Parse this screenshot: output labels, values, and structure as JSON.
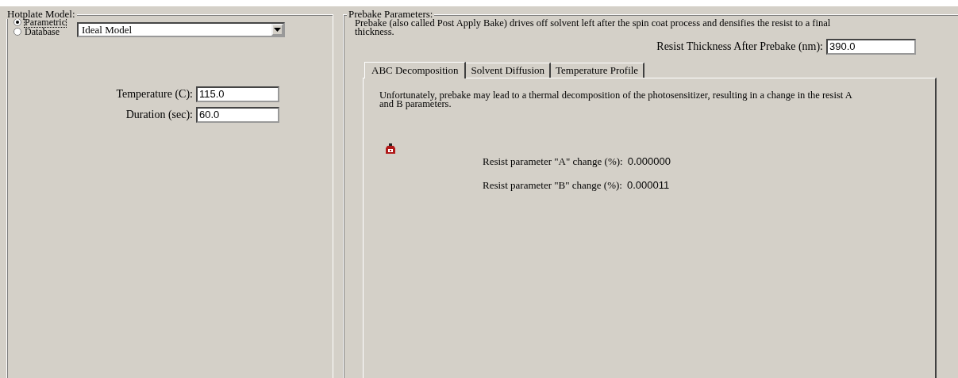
{
  "hotplate": {
    "title": "Hotplate Model:",
    "radios": [
      {
        "label": "Parametric",
        "selected": true,
        "focused": true
      },
      {
        "label": "Database",
        "selected": false,
        "focused": false
      }
    ],
    "model_dropdown": {
      "value": "Ideal Model"
    },
    "fields": [
      {
        "label": "Temperature (C):",
        "value": "115.0"
      },
      {
        "label": "Duration (sec):",
        "value": "60.0"
      }
    ]
  },
  "prebake": {
    "title": "Prebake Parameters:",
    "description": "Prebake (also called Post Apply Bake) drives off solvent left after the spin coat process and densifies the resist to a final thickness.",
    "thickness": {
      "label": "Resist Thickness After Prebake (nm):",
      "value": "390.0"
    },
    "tabs": [
      {
        "label": "ABC Decomposition",
        "selected": true
      },
      {
        "label": "Solvent Diffusion",
        "selected": false
      },
      {
        "label": "Temperature Profile",
        "selected": false
      }
    ],
    "panel": {
      "note": "Unfortunately, prebake may lead to a thermal decomposition of the photosensitizer, resulting in a change in the resist A and B parameters.",
      "results": [
        {
          "label": "Resist parameter \"A\" change (%):",
          "value": "0.000000"
        },
        {
          "label": "Resist parameter \"B\" change (%):",
          "value": "0.000011"
        }
      ]
    }
  }
}
